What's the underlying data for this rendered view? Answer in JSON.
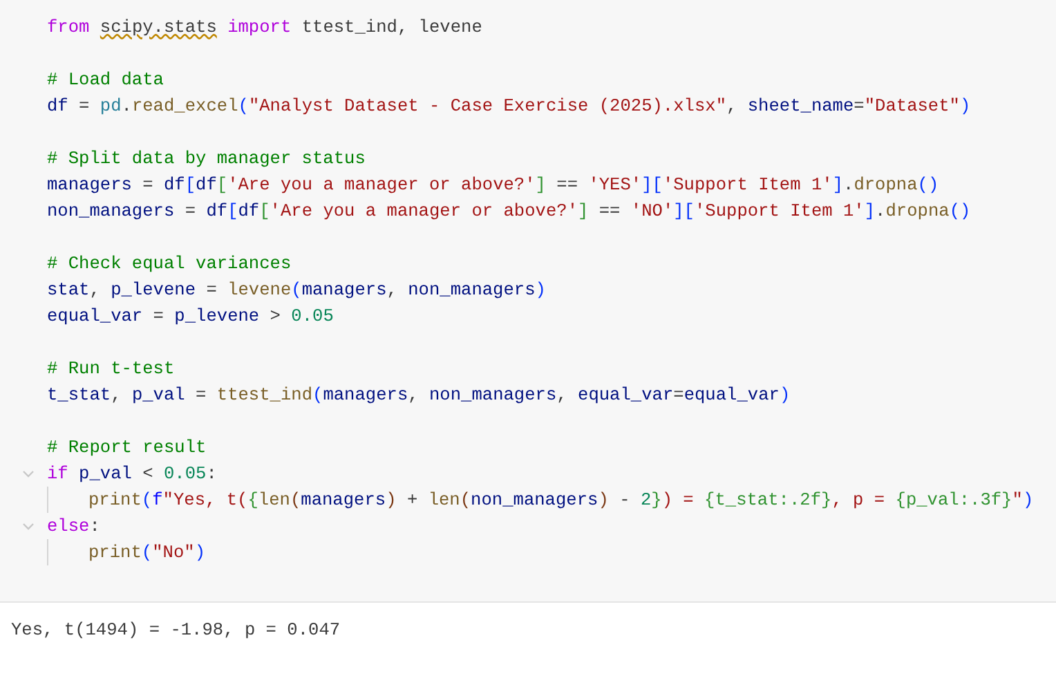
{
  "code_cell": {
    "lines": [
      {
        "kind": "code",
        "tokens": [
          {
            "text": "from ",
            "kind": "kw"
          },
          {
            "text": "scipy.stats",
            "kind": "modw"
          },
          {
            "text": " import",
            "kind": "kw"
          },
          {
            "text": " ttest_ind, levene",
            "kind": "plain"
          }
        ]
      },
      {
        "kind": "blank"
      },
      {
        "kind": "code",
        "tokens": [
          {
            "text": "# Load data",
            "kind": "com"
          }
        ]
      },
      {
        "kind": "code",
        "tokens": [
          {
            "text": "df",
            "kind": "var"
          },
          {
            "text": " = ",
            "kind": "plain"
          },
          {
            "text": "pd",
            "kind": "mod"
          },
          {
            "text": ".",
            "kind": "plain"
          },
          {
            "text": "read_excel",
            "kind": "fn"
          },
          {
            "text": "(",
            "kind": "br1"
          },
          {
            "text": "\"Analyst Dataset - Case Exercise (2025).xlsx\"",
            "kind": "str"
          },
          {
            "text": ", ",
            "kind": "plain"
          },
          {
            "text": "sheet_name",
            "kind": "var"
          },
          {
            "text": "=",
            "kind": "plain"
          },
          {
            "text": "\"Dataset\"",
            "kind": "str"
          },
          {
            "text": ")",
            "kind": "br1"
          }
        ]
      },
      {
        "kind": "blank"
      },
      {
        "kind": "code",
        "tokens": [
          {
            "text": "# Split data by manager status",
            "kind": "com"
          }
        ]
      },
      {
        "kind": "code",
        "tokens": [
          {
            "text": "managers",
            "kind": "var"
          },
          {
            "text": " = ",
            "kind": "plain"
          },
          {
            "text": "df",
            "kind": "var"
          },
          {
            "text": "[",
            "kind": "br1"
          },
          {
            "text": "df",
            "kind": "var"
          },
          {
            "text": "[",
            "kind": "br2"
          },
          {
            "text": "'Are you a manager or above?'",
            "kind": "str"
          },
          {
            "text": "]",
            "kind": "br2"
          },
          {
            "text": " == ",
            "kind": "plain"
          },
          {
            "text": "'YES'",
            "kind": "str"
          },
          {
            "text": "][",
            "kind": "br1"
          },
          {
            "text": "'Support Item 1'",
            "kind": "str"
          },
          {
            "text": "]",
            "kind": "br1"
          },
          {
            "text": ".",
            "kind": "plain"
          },
          {
            "text": "dropna",
            "kind": "fn"
          },
          {
            "text": "()",
            "kind": "br1"
          }
        ]
      },
      {
        "kind": "code",
        "tokens": [
          {
            "text": "non_managers",
            "kind": "var"
          },
          {
            "text": " = ",
            "kind": "plain"
          },
          {
            "text": "df",
            "kind": "var"
          },
          {
            "text": "[",
            "kind": "br1"
          },
          {
            "text": "df",
            "kind": "var"
          },
          {
            "text": "[",
            "kind": "br2"
          },
          {
            "text": "'Are you a manager or above?'",
            "kind": "str"
          },
          {
            "text": "]",
            "kind": "br2"
          },
          {
            "text": " == ",
            "kind": "plain"
          },
          {
            "text": "'NO'",
            "kind": "str"
          },
          {
            "text": "][",
            "kind": "br1"
          },
          {
            "text": "'Support Item 1'",
            "kind": "str"
          },
          {
            "text": "]",
            "kind": "br1"
          },
          {
            "text": ".",
            "kind": "plain"
          },
          {
            "text": "dropna",
            "kind": "fn"
          },
          {
            "text": "()",
            "kind": "br1"
          }
        ]
      },
      {
        "kind": "blank"
      },
      {
        "kind": "code",
        "tokens": [
          {
            "text": "# Check equal variances",
            "kind": "com"
          }
        ]
      },
      {
        "kind": "code",
        "tokens": [
          {
            "text": "stat",
            "kind": "var"
          },
          {
            "text": ", ",
            "kind": "plain"
          },
          {
            "text": "p_levene",
            "kind": "var"
          },
          {
            "text": " = ",
            "kind": "plain"
          },
          {
            "text": "levene",
            "kind": "fn"
          },
          {
            "text": "(",
            "kind": "br1"
          },
          {
            "text": "managers",
            "kind": "var"
          },
          {
            "text": ", ",
            "kind": "plain"
          },
          {
            "text": "non_managers",
            "kind": "var"
          },
          {
            "text": ")",
            "kind": "br1"
          }
        ]
      },
      {
        "kind": "code",
        "tokens": [
          {
            "text": "equal_var",
            "kind": "var"
          },
          {
            "text": " = ",
            "kind": "plain"
          },
          {
            "text": "p_levene",
            "kind": "var"
          },
          {
            "text": " > ",
            "kind": "plain"
          },
          {
            "text": "0.05",
            "kind": "num"
          }
        ]
      },
      {
        "kind": "blank"
      },
      {
        "kind": "code",
        "tokens": [
          {
            "text": "# Run t-test",
            "kind": "com"
          }
        ]
      },
      {
        "kind": "code",
        "tokens": [
          {
            "text": "t_stat",
            "kind": "var"
          },
          {
            "text": ", ",
            "kind": "plain"
          },
          {
            "text": "p_val",
            "kind": "var"
          },
          {
            "text": " = ",
            "kind": "plain"
          },
          {
            "text": "ttest_ind",
            "kind": "fn"
          },
          {
            "text": "(",
            "kind": "br1"
          },
          {
            "text": "managers",
            "kind": "var"
          },
          {
            "text": ", ",
            "kind": "plain"
          },
          {
            "text": "non_managers",
            "kind": "var"
          },
          {
            "text": ", ",
            "kind": "plain"
          },
          {
            "text": "equal_var",
            "kind": "var"
          },
          {
            "text": "=",
            "kind": "plain"
          },
          {
            "text": "equal_var",
            "kind": "var"
          },
          {
            "text": ")",
            "kind": "br1"
          }
        ]
      },
      {
        "kind": "blank"
      },
      {
        "kind": "code",
        "tokens": [
          {
            "text": "# Report result",
            "kind": "com"
          }
        ]
      },
      {
        "kind": "code",
        "tokens": [
          {
            "text": "if ",
            "kind": "kw"
          },
          {
            "text": "p_val",
            "kind": "var"
          },
          {
            "text": " < ",
            "kind": "plain"
          },
          {
            "text": "0.05",
            "kind": "num"
          },
          {
            "text": ":",
            "kind": "plain"
          }
        ],
        "children": [
          {
            "kind": "code",
            "tokens": [
              {
                "text": "print",
                "kind": "fn"
              },
              {
                "text": "(",
                "kind": "br1"
              },
              {
                "text": "f",
                "kind": "fpre"
              },
              {
                "text": "\"Yes, t(",
                "kind": "str"
              },
              {
                "text": "{",
                "kind": "br2"
              },
              {
                "text": "len",
                "kind": "fn"
              },
              {
                "text": "(",
                "kind": "br3"
              },
              {
                "text": "managers",
                "kind": "var"
              },
              {
                "text": ")",
                "kind": "br3"
              },
              {
                "text": " + ",
                "kind": "plain"
              },
              {
                "text": "len",
                "kind": "fn"
              },
              {
                "text": "(",
                "kind": "br3"
              },
              {
                "text": "non_managers",
                "kind": "var"
              },
              {
                "text": ")",
                "kind": "br3"
              },
              {
                "text": " - ",
                "kind": "plain"
              },
              {
                "text": "2",
                "kind": "num"
              },
              {
                "text": "}",
                "kind": "br2"
              },
              {
                "text": ") = ",
                "kind": "str"
              },
              {
                "text": "{t_stat:.2f}",
                "kind": "br2"
              },
              {
                "text": ", p = ",
                "kind": "str"
              },
              {
                "text": "{p_val:.3f}",
                "kind": "br2"
              },
              {
                "text": "\"",
                "kind": "str"
              },
              {
                "text": ")",
                "kind": "br1"
              }
            ]
          }
        ]
      },
      {
        "kind": "code",
        "tokens": [
          {
            "text": "else",
            "kind": "kw"
          },
          {
            "text": ":",
            "kind": "plain"
          }
        ],
        "children": [
          {
            "kind": "code",
            "tokens": [
              {
                "text": "print",
                "kind": "fn"
              },
              {
                "text": "(",
                "kind": "br1"
              },
              {
                "text": "\"No\"",
                "kind": "str"
              },
              {
                "text": ")",
                "kind": "br1"
              }
            ]
          }
        ]
      }
    ]
  },
  "output": {
    "text": "Yes, t(1494) = -1.98, p = 0.047"
  }
}
